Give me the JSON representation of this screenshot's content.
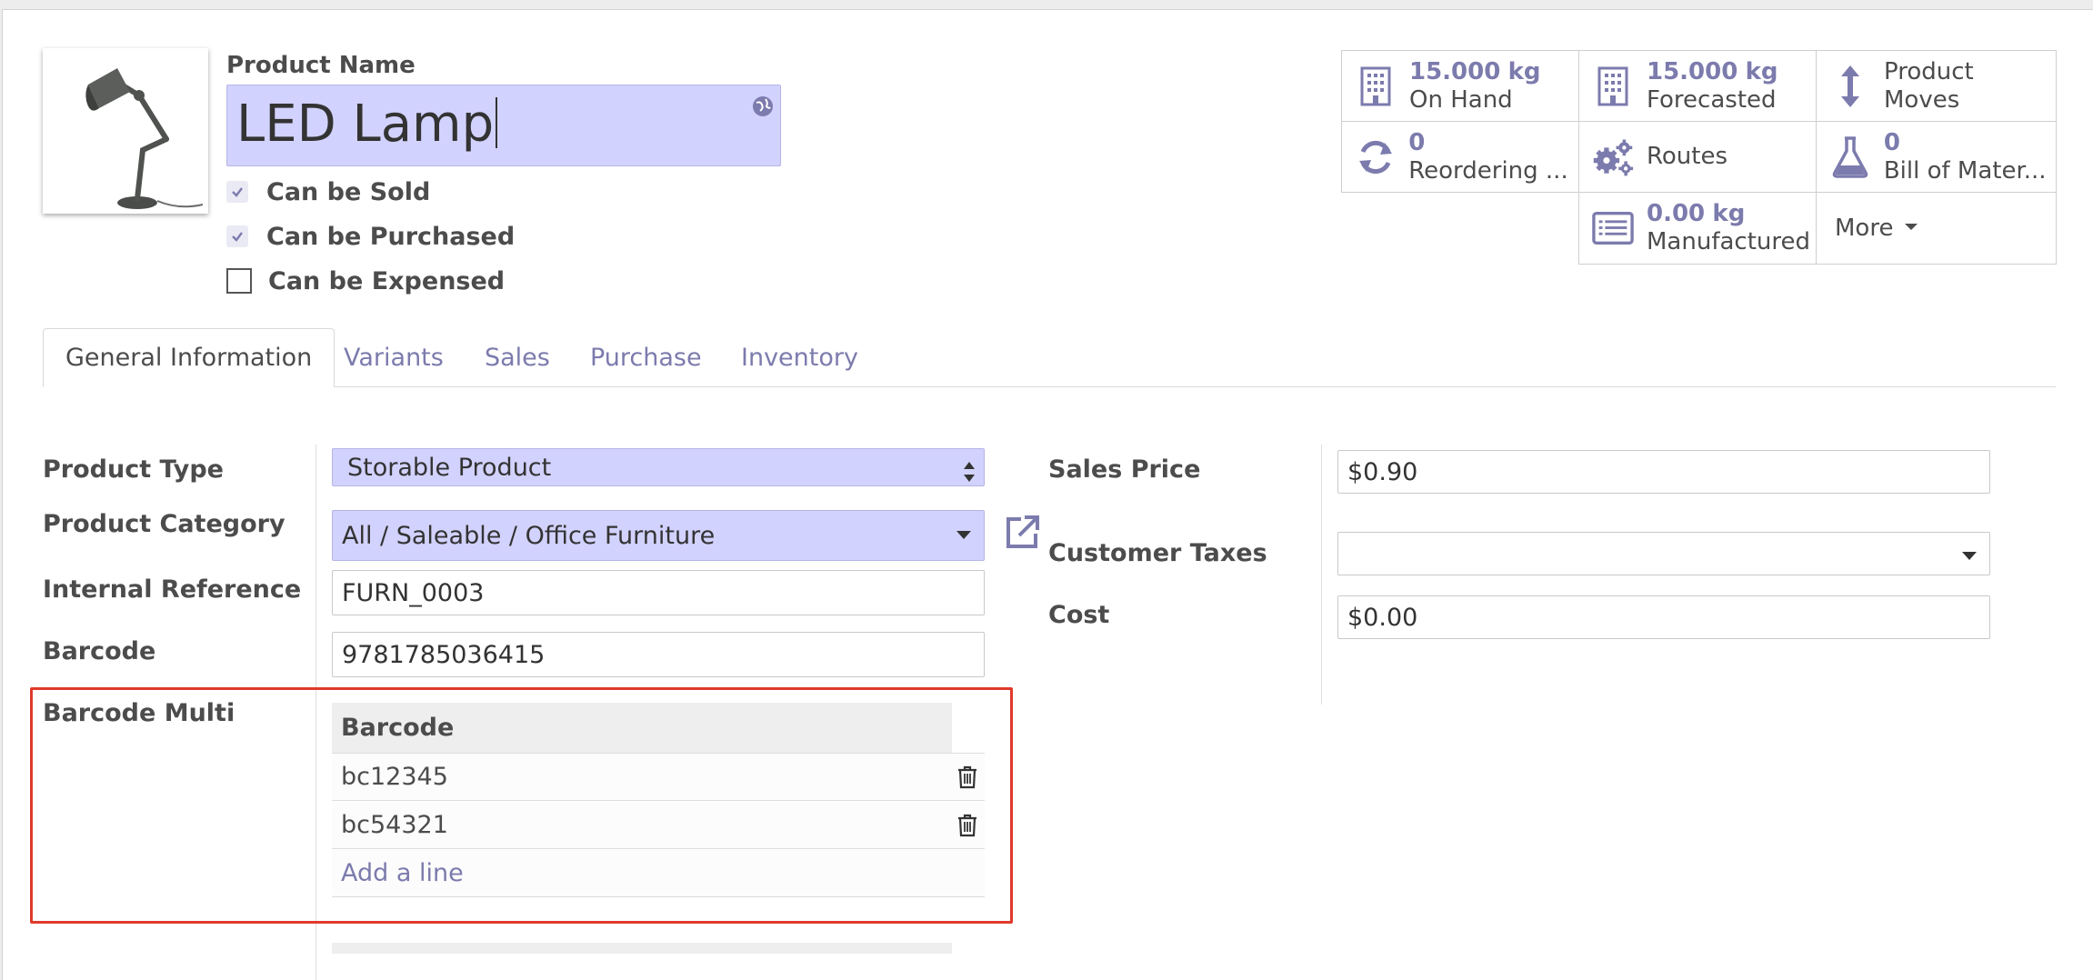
{
  "product": {
    "name_label": "Product Name",
    "name_value": "LED Lamp",
    "checkboxes": [
      {
        "label": "Can be Sold",
        "checked": true
      },
      {
        "label": "Can be Purchased",
        "checked": true
      },
      {
        "label": "Can be Expensed",
        "checked": false
      }
    ]
  },
  "smart_buttons": {
    "on_hand": {
      "value": "15.000",
      "unit": "kg",
      "label": "On Hand",
      "icon": "building-icon"
    },
    "forecasted": {
      "value": "15.000",
      "unit": "kg",
      "label": "Forecasted",
      "icon": "building-icon"
    },
    "product_moves": {
      "line1": "Product",
      "line2": "Moves",
      "icon": "up-down-arrow-icon"
    },
    "reordering": {
      "value": "0",
      "label": "Reordering ...",
      "icon": "refresh-icon"
    },
    "routes": {
      "label": "Routes",
      "icon": "gears-icon"
    },
    "bom": {
      "value": "0",
      "label": "Bill of Mater...",
      "icon": "flask-icon"
    },
    "manufactured": {
      "value": "0.00",
      "unit": "kg",
      "label": "Manufactured",
      "icon": "list-icon"
    },
    "more": {
      "label": "More"
    }
  },
  "tabs": [
    "General Information",
    "Variants",
    "Sales",
    "Purchase",
    "Inventory"
  ],
  "form": {
    "product_type": {
      "label": "Product Type",
      "value": "Storable Product"
    },
    "product_category": {
      "label": "Product Category",
      "value": "All / Saleable / Office Furniture"
    },
    "internal_reference": {
      "label": "Internal Reference",
      "value": "FURN_0003"
    },
    "barcode": {
      "label": "Barcode",
      "value": "9781785036415"
    },
    "barcode_multi": {
      "label": "Barcode Multi",
      "column_header": "Barcode",
      "rows": [
        "bc12345",
        "bc54321"
      ],
      "add_line": "Add a line"
    },
    "sales_price": {
      "label": "Sales Price",
      "value": "$0.90"
    },
    "customer_taxes": {
      "label": "Customer Taxes",
      "value": ""
    },
    "cost": {
      "label": "Cost",
      "value": "$0.00"
    }
  },
  "colors": {
    "accent": "#7c7bad",
    "required_field_bg": "#d2d2ff",
    "highlight_border": "#e03a2b"
  }
}
